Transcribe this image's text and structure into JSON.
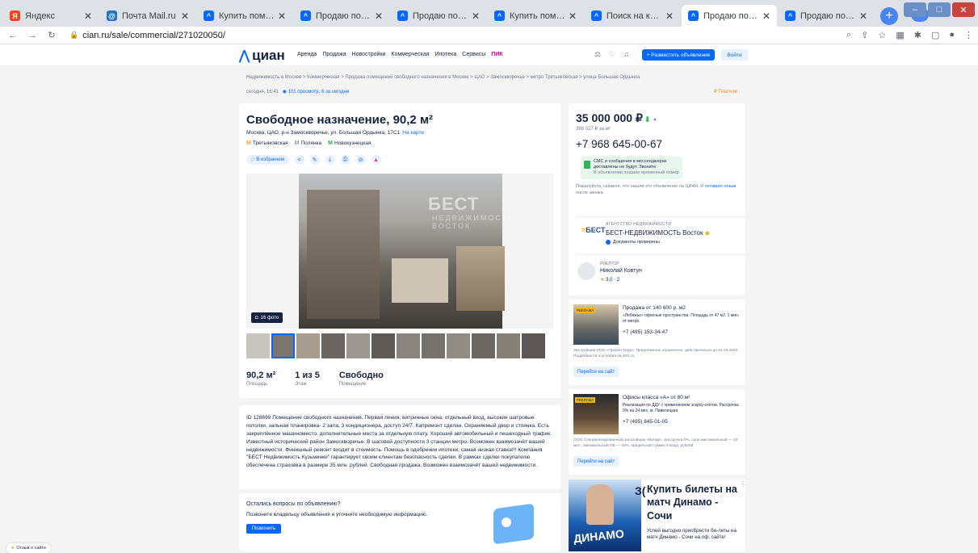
{
  "browser": {
    "tabs": [
      {
        "title": "Яндекс",
        "icon": "yandex-icon",
        "color": "#fc3f1d",
        "glyph": "Я"
      },
      {
        "title": "Почта Mail.ru",
        "icon": "mail-icon",
        "color": "#1f75cb",
        "glyph": "@"
      },
      {
        "title": "Купить помещение св",
        "icon": "cian-icon",
        "color": "#0468ff",
        "glyph": "^"
      },
      {
        "title": "Продаю помещение с",
        "icon": "cian-icon",
        "color": "#0468ff",
        "glyph": "^"
      },
      {
        "title": "Продаю помещение с",
        "icon": "cian-icon",
        "color": "#0468ff",
        "glyph": "^"
      },
      {
        "title": "Купить помещение св",
        "icon": "cian-icon",
        "color": "#0468ff",
        "glyph": "^"
      },
      {
        "title": "Поиск на карте ЦИАН",
        "icon": "cian-icon",
        "color": "#0468ff",
        "glyph": "^"
      },
      {
        "title": "Продаю помещение с",
        "icon": "cian-icon",
        "color": "#0468ff",
        "glyph": "^"
      },
      {
        "title": "Продаю помещение с",
        "icon": "cian-icon",
        "color": "#0468ff",
        "glyph": "^"
      }
    ],
    "url": "cian.ru/sale/commercial/271020050/"
  },
  "header": {
    "logo": "циан",
    "nav": [
      "Аренда",
      "Продажа",
      "Новостройки",
      "Коммерческая",
      "Ипотека",
      "Сервисы"
    ],
    "pik": "ПИК",
    "post_button": "+ Разместить объявление",
    "login_button": "Войти"
  },
  "breadcrumbs": "Недвижимость в Москве  >  Коммерческая  >  Продажа помещений свободного назначения в Москве  >  ЦАО  >  Замоскворечье  >  метро Третьяковская  >  улица Большая Ордынка",
  "meta": {
    "updated": "сегодня, 16:41",
    "views": "101 просмотр, 6 за сегодня",
    "paid": "Платное"
  },
  "listing": {
    "title": "Свободное назначение, 90,2 м²",
    "address": "Москва, ЦАО, р-н Замоскворечье, ул. Большая Ордынка, 17С1",
    "map_link": "На карте",
    "metro": [
      {
        "name": "Третьяковская",
        "color": "#f3a31b"
      },
      {
        "name": "Полянка",
        "color": "#9aa0a6"
      },
      {
        "name": "Новокузнецкая",
        "color": "#2fa84f"
      }
    ],
    "favorite": "В избранное",
    "photo_watermark": "БЕСТ",
    "photo_watermark_sub": "НЕДВИЖИМОСТЬ ВОСТОК",
    "photo_count": "16 фото",
    "facts": [
      {
        "value": "90,2 м²",
        "label": "Площадь"
      },
      {
        "value": "1 из 5",
        "label": "Этаж"
      },
      {
        "value": "Свободно",
        "label": "Помещение"
      }
    ],
    "description": "ID 128699 Помещение свободного назначения. Первая линия, витринные окна, отдельный вход, высокие шатровые потолки, зальная планировка- 2 зала, 3 кондиционера, доступ 24/7. Капремонт сделан. Охраняемый двор и стоянка. Есть закреплённое машиноместо, дополнительные места за отдельную плату. Хороший автомобильный и пешеходный трафик. Известный исторический район Замоскворечье. В шаговой доступности 3 станции метро. Возможен взаимозачёт вашей недвижимости. Финишный ремонт входит в стоимость. Помощь в одобрении ипотеки, самая низкая ставка!!! Компания \"БЕСТ Недвижимость Кузьминки\" гарантирует своим клиентам безопасность сделки. В рамках сделки покупателю обеспечена страховка в размере 35 млн. рублей. Свободная продажа. Возможен взаимозачёт вашей недвижимости."
  },
  "question": {
    "title": "Остались вопросы по объявлению?",
    "subtitle": "Позвоните владельцу объявления и уточните необходимую информацию.",
    "button": "Позвонить"
  },
  "contact": {
    "price": "35 000 000 ₽",
    "price_per_m": "388 027 ₽ за м²",
    "phone": "+7 968 645-00-67",
    "sms_1": "СМС и сообщения в мессенджерах",
    "sms_2": "доставлены не будут. Звоните",
    "sms_3": "В объявлении показан временный номер",
    "please": "Пожалуйста, скажите, что нашли это объявление на ЦИАН. И",
    "please_link": "оставьте отзыв",
    "please_end": "после звонка",
    "agency_label": "АГЕНТСТВО НЕДВИЖИМОСТИ",
    "agency_logo": "БЕСТ",
    "agency_name": "БЕСТ-НЕДВИЖИМОСТЬ Восток",
    "agency_docs": "Документы проверены",
    "realtor_label": "РИЕЛТОР",
    "realtor_name": "Николай Ковтун",
    "realtor_rating": "3,0 · 2"
  },
  "ads": [
    {
      "tag": "РЕКЛАМА",
      "title": "Продажа от 140 600 р. м2",
      "subtitle": "«Лебяжье» офисные пространства. Площадь от 47 м2. 1 мин. от метро.",
      "phone": "+7 (495) 153-34-47",
      "legal": "Застройщик ООО «Промет-Град». Предложение ограничено, действительно до 31.03.2022. Подробности и условия на st01.ru",
      "button": "Перейти на сайт"
    },
    {
      "tag": "РЕКЛАМА",
      "title": "Офисы класса «А» от 80 м²",
      "subtitle": "Реализация по ДДУ с применением эскроу-счетов. Рассрочка 0% на 24 мес. м. Павелецкая",
      "phone": "+7 (495) 845-01-05",
      "legal": "ООО Специализированный застройщик «Вилар», рассрочка 0%, срок максимальный — 24 мес., минимальный ПВ — 30%, предельная сумма 3 млрд. рублей",
      "button": "Перейти на сайт"
    }
  ],
  "promo": {
    "cut": "З(",
    "title": "Купить билеты на матч Динамо - Сочи",
    "subtitle": "Успей выгодно приобрести би-леты на матч Динамо - Сочи на оф. сайте!",
    "word": "ДИНАМО"
  },
  "feedback": "Отзыв о сайте"
}
